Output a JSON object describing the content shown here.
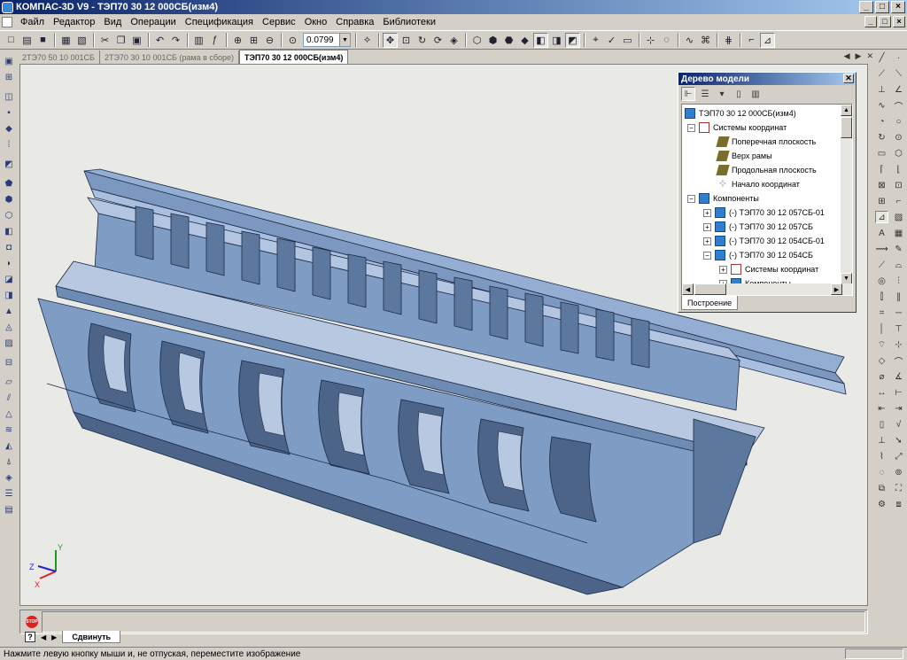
{
  "window": {
    "title": "КОМПАС-3D V9 - ТЭП70 30 12 000СБ(изм4)",
    "buttons": [
      "_",
      "□",
      "×"
    ]
  },
  "menu": {
    "items": [
      "Файл",
      "Редактор",
      "Вид",
      "Операции",
      "Спецификация",
      "Сервис",
      "Окно",
      "Справка",
      "Библиотеки"
    ]
  },
  "toolbar": {
    "zoom_value": "0.0799"
  },
  "tabs": [
    {
      "label": "2ТЭ70 50 10 001СБ",
      "active": false
    },
    {
      "label": "2ТЭ70 30 10 001СБ (рама в сборе)",
      "active": false
    },
    {
      "label": "ТЭП70 30 12 000СБ(изм4)",
      "active": true
    }
  ],
  "tree": {
    "title": "Дерево модели",
    "nodes": [
      {
        "label": "ТЭП70 30 12 000СБ(изм4)",
        "icon": "assembly-icon",
        "expander": ""
      },
      {
        "label": "Системы координат",
        "icon": "coordinate-system-icon",
        "expander": "−"
      },
      {
        "label": "Поперечная плоскость",
        "icon": "plane-icon",
        "expander": ""
      },
      {
        "label": "Верх рамы",
        "icon": "plane-icon",
        "expander": ""
      },
      {
        "label": "Продольная плоскость",
        "icon": "plane-icon",
        "expander": ""
      },
      {
        "label": "Начало координат",
        "icon": "origin-icon",
        "expander": ""
      },
      {
        "label": "Компоненты",
        "icon": "components-icon",
        "expander": "−"
      },
      {
        "label": "(-) ТЭП70 30 12 057СБ-01",
        "icon": "assembly-icon",
        "expander": "+"
      },
      {
        "label": "(-) ТЭП70 30 12 057СБ",
        "icon": "assembly-icon",
        "expander": "+"
      },
      {
        "label": "(-) ТЭП70 30 12 054СБ-01",
        "icon": "assembly-icon",
        "expander": "+"
      },
      {
        "label": "(-) ТЭП70 30 12 054СБ",
        "icon": "assembly-icon",
        "expander": "−"
      },
      {
        "label": "Системы координат",
        "icon": "coordinate-system-icon",
        "expander": "+"
      },
      {
        "label": "Компоненты",
        "icon": "components-icon",
        "expander": "+"
      }
    ],
    "bottom_tab": "Построение"
  },
  "axes": {
    "x": "X",
    "y": "Y",
    "z": "Z"
  },
  "bottom": {
    "stop_label": "STOP",
    "help_label": "?",
    "tab_label": "Сдвинуть"
  },
  "status": {
    "text": "Нажмите левую кнопку мыши и, не отпуская, переместите изображение"
  },
  "colors": {
    "model_face": "#7f9cc4",
    "model_light": "#b8c8e0",
    "model_dark": "#4c6488",
    "viewport_bg": "#e9e9e6",
    "titlebar": "#0a246a"
  }
}
